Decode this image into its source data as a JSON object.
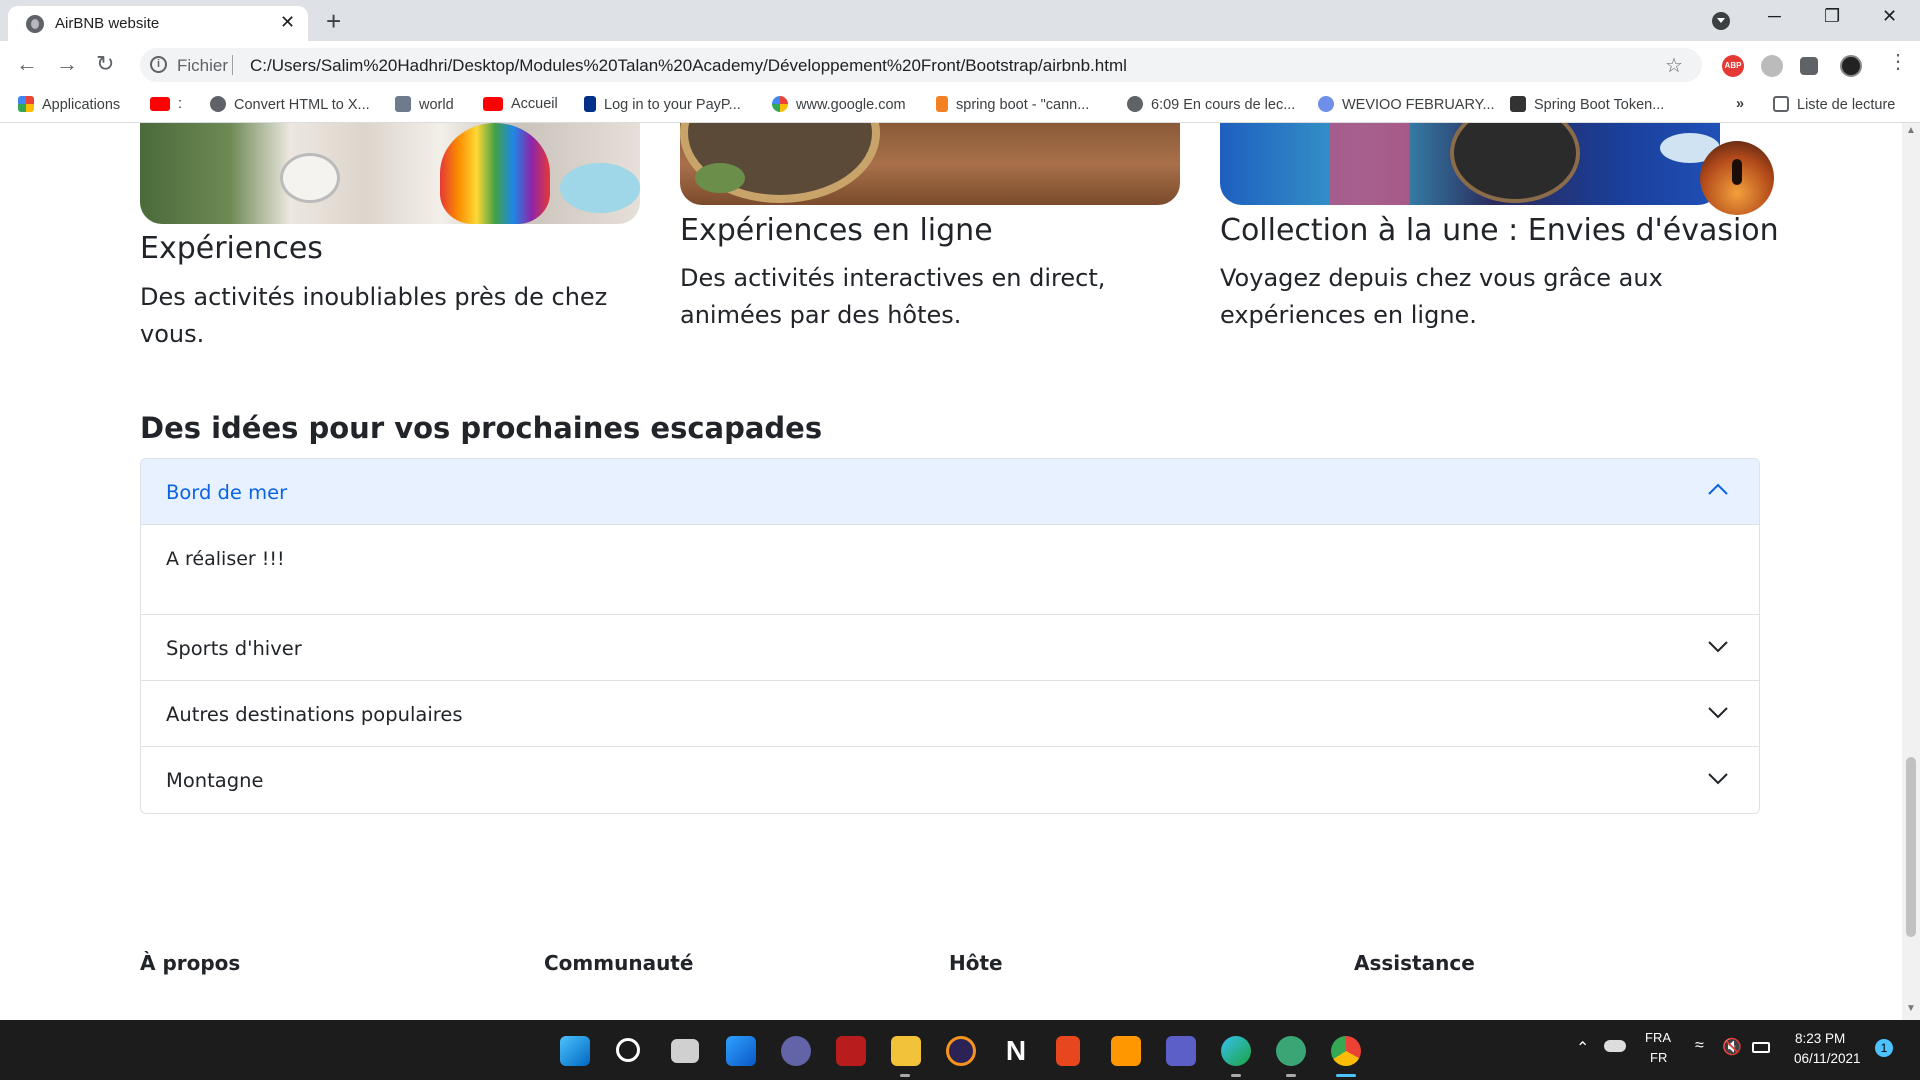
{
  "browser": {
    "tab_title": "AirBNB website",
    "tab_close": "✕",
    "new_tab": "+",
    "window_controls": [
      "─",
      "❐",
      "✕"
    ],
    "scheme_label": "Fichier",
    "url": "C:/Users/Salim%20Hadhri/Desktop/Modules%20Talan%20Academy/Développement%20Front/Bootstrap/airbnb.html",
    "info_icon": "i",
    "bookmark_star_icon": "star-icon",
    "abp_label": "ABP"
  },
  "bookmarks": {
    "items": [
      {
        "label": "Applications",
        "icon": "apps-grid-icon",
        "color": "#4285f4"
      },
      {
        "label": ":",
        "icon": "youtube-icon",
        "color": "#ff0000"
      },
      {
        "label": "Convert HTML to X...",
        "icon": "globe-icon",
        "color": "#5f6368"
      },
      {
        "label": "world",
        "icon": "map-icon",
        "color": "#6d7b8d"
      },
      {
        "label": "Accueil",
        "icon": "youtube-icon",
        "color": "#ff0000"
      },
      {
        "label": "Log in to your PayP...",
        "icon": "paypal-icon",
        "color": "#003087"
      },
      {
        "label": "www.google.com",
        "icon": "google-icon",
        "color": "#4285f4"
      },
      {
        "label": "spring boot - \"cann...",
        "icon": "stackoverflow-icon",
        "color": "#f48024"
      },
      {
        "label": "6:09 En cours de lec...",
        "icon": "globe-icon",
        "color": "#5f6368"
      },
      {
        "label": "WEVIOO FEBRUARY...",
        "icon": "wevioo-icon",
        "color": "#6f8fe8"
      },
      {
        "label": "Spring Boot Token...",
        "icon": "zengo-icon",
        "color": "#333333"
      }
    ],
    "overflow": "»",
    "reading_list": "Liste de lecture"
  },
  "cards": [
    {
      "title": "Expériences",
      "description": "Des activités inoubliables près de chez vous."
    },
    {
      "title": "Expériences en ligne",
      "description": "Des activités interactives en direct, animées par des hôtes."
    },
    {
      "title": "Collection à la une : Envies d'évasion",
      "description": "Voyagez depuis chez vous grâce aux expériences en ligne."
    }
  ],
  "ideas": {
    "heading": "Des idées pour vos prochaines escapades",
    "accordion": [
      {
        "label": "Bord de mer",
        "open": true,
        "body": "A réaliser !!!"
      },
      {
        "label": "Sports d'hiver",
        "open": false
      },
      {
        "label": "Autres destinations populaires",
        "open": false
      },
      {
        "label": "Montagne",
        "open": false
      }
    ]
  },
  "footer": {
    "columns": [
      "À propos",
      "Communauté",
      "Hôte",
      "Assistance"
    ]
  },
  "taskbar": {
    "apps": [
      "windows-start-icon",
      "search-icon",
      "task-view-icon",
      "widgets-icon",
      "teams-chat-icon",
      "game-icon",
      "file-explorer-icon",
      "eclipse-icon",
      "notion-icon",
      "office-icon",
      "sublime-text-icon",
      "teams-icon",
      "edge-icon",
      "chatgpt-icon",
      "chrome-icon"
    ],
    "lang_top": "FRA",
    "lang_bottom": "FR",
    "time": "8:23 PM",
    "date": "06/11/2021",
    "notification_count": "1"
  },
  "colors": {
    "accordion_active_bg": "#e7f1ff",
    "accordion_active_text": "#0c63e4",
    "taskbar_bg": "#1c1c1c"
  }
}
